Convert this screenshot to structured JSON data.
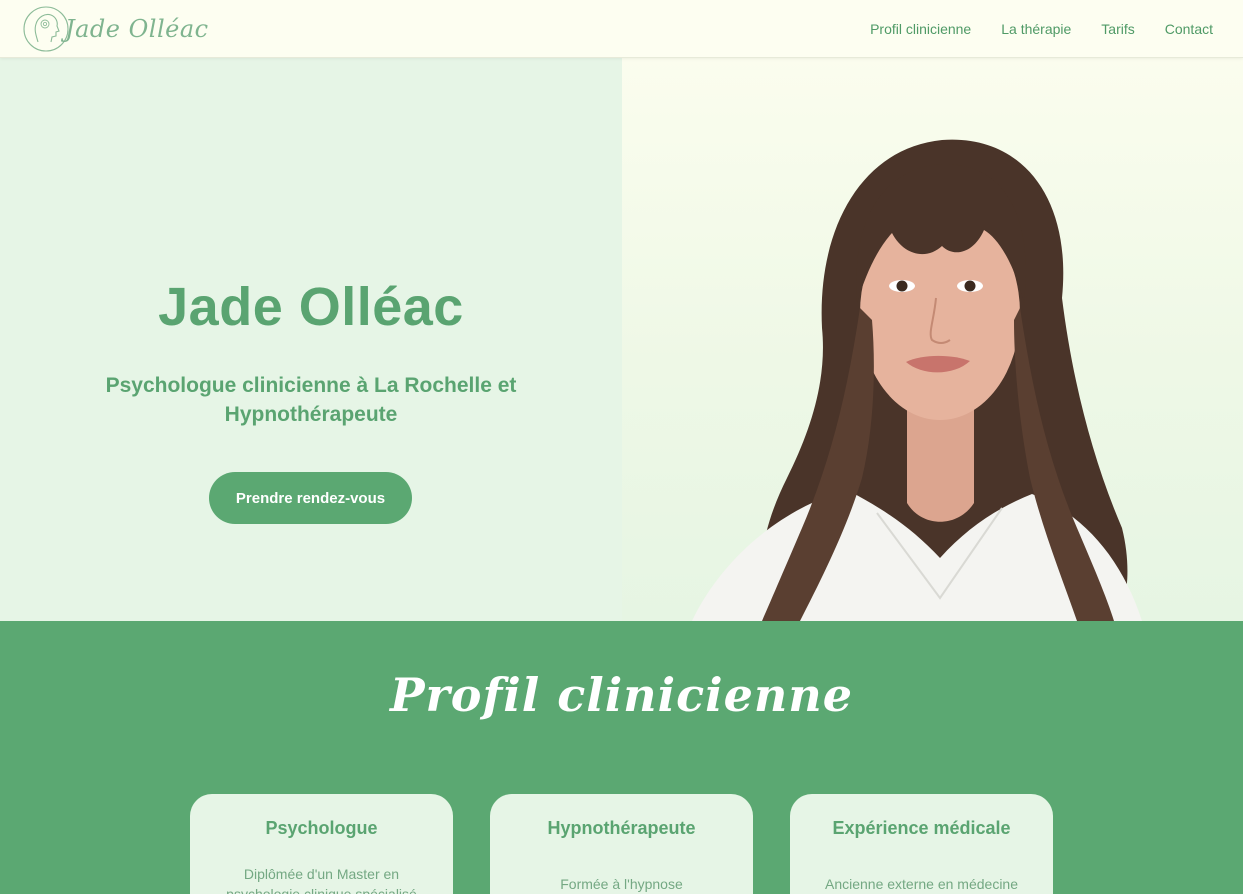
{
  "header": {
    "logo_text": "Jade Olléac",
    "nav": [
      "Profil clinicienne",
      "La thérapie",
      "Tarifs",
      "Contact"
    ]
  },
  "hero": {
    "name": "Jade Olléac",
    "subtitle_line1": "Psychologue clinicienne à La Rochelle et",
    "subtitle_line2": "Hypnothérapeute",
    "cta_label": "Prendre rendez-vous"
  },
  "profil": {
    "title": "Profil clinicienne",
    "cards": [
      {
        "title": "Psychologue",
        "text_line1": "Diplômée d'un Master en",
        "text_line2": "psychologie clinique spécialisé"
      },
      {
        "title": "Hypnothérapeute",
        "text_line1": "Formée à l'hypnose"
      },
      {
        "title": "Expérience médicale",
        "text_line1": "Ancienne externe en médecine"
      }
    ]
  },
  "colors": {
    "brand_green": "#5ba872",
    "light_green": "#e6f5e6",
    "header_bg": "#fdfef1"
  }
}
